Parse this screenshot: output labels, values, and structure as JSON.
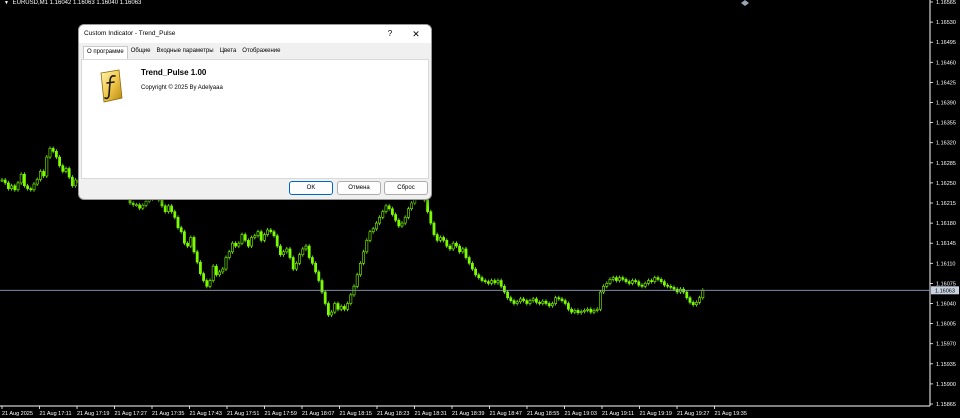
{
  "chart": {
    "symbol_label": "EURUSD,M1",
    "ohlc": "1.16042 1.16063 1.16040 1.16063",
    "current_price": "1.16063",
    "price_ticks": [
      "1.16565",
      "1.16530",
      "1.16495",
      "1.16460",
      "1.16425",
      "1.16390",
      "1.16355",
      "1.16320",
      "1.16285",
      "1.16250",
      "1.16215",
      "1.16180",
      "1.16145",
      "1.16110",
      "1.16075",
      "1.16040",
      "1.16005",
      "1.15970",
      "1.15935",
      "1.15900",
      "1.15865"
    ],
    "time_ticks": [
      "21 Aug 2025",
      "21 Aug 17:11",
      "21 Aug 17:19",
      "21 Aug 17:27",
      "21 Aug 17:35",
      "21 Aug 17:43",
      "21 Aug 17:51",
      "21 Aug 17:59",
      "21 Aug 18:07",
      "21 Aug 18:15",
      "21 Aug 18:23",
      "21 Aug 18:31",
      "21 Aug 18:39",
      "21 Aug 18:47",
      "21 Aug 18:55",
      "21 Aug 19:03",
      "21 Aug 19:11",
      "21 Aug 19:19",
      "21 Aug 19:27",
      "21 Aug 19:35"
    ],
    "closes": [
      1.16255,
      1.1625,
      1.1624,
      1.16245,
      1.16238,
      1.1625,
      1.16265,
      1.16245,
      1.1624,
      1.16238,
      1.16248,
      1.16256,
      1.1627,
      1.16262,
      1.16295,
      1.1631,
      1.16305,
      1.16295,
      1.1628,
      1.1627,
      1.16275,
      1.1626,
      1.16245,
      1.16255,
      1.1625,
      1.16265,
      1.1628,
      1.1629,
      1.16282,
      1.16295,
      1.16288,
      1.1626,
      1.1625,
      1.16245,
      1.16242,
      1.16236,
      1.1623,
      1.16235,
      1.16243,
      1.16232,
      1.16215,
      1.16212,
      1.16212,
      1.16206,
      1.16211,
      1.16218,
      1.16222,
      1.16226,
      1.1623,
      1.1622,
      1.1621,
      1.162,
      1.1621,
      1.162,
      1.1619,
      1.16172,
      1.16165,
      1.16145,
      1.1614,
      1.16155,
      1.1613,
      1.16112,
      1.16092,
      1.1608,
      1.1607,
      1.1608,
      1.16105,
      1.1609,
      1.16095,
      1.161,
      1.1612,
      1.1613,
      1.16145,
      1.1614,
      1.16145,
      1.1616,
      1.1615,
      1.1614,
      1.16155,
      1.16158,
      1.16165,
      1.1615,
      1.1616,
      1.16168,
      1.16165,
      1.16158,
      1.1614,
      1.16125,
      1.1613,
      1.16135,
      1.1612,
      1.161,
      1.1611,
      1.16125,
      1.16135,
      1.1614,
      1.1612,
      1.1611,
      1.16095,
      1.1608,
      1.1606,
      1.1604,
      1.1602,
      1.16025,
      1.1604,
      1.1603,
      1.16035,
      1.1603,
      1.1604,
      1.16055,
      1.1607,
      1.1609,
      1.1611,
      1.1613,
      1.1615,
      1.16165,
      1.1617,
      1.1618,
      1.1619,
      1.162,
      1.1621,
      1.16205,
      1.16195,
      1.16185,
      1.16175,
      1.1618,
      1.1619,
      1.16205,
      1.16215,
      1.16225,
      1.1623,
      1.16235,
      1.1622,
      1.162,
      1.1618,
      1.1616,
      1.1615,
      1.16155,
      1.1615,
      1.1614,
      1.16135,
      1.16145,
      1.1614,
      1.1613,
      1.16135,
      1.1612,
      1.1611,
      1.161,
      1.1609,
      1.16085,
      1.1608,
      1.16078,
      1.16075,
      1.1608,
      1.16076,
      1.1608,
      1.1607,
      1.1606,
      1.1605,
      1.16045,
      1.1604,
      1.16043,
      1.16048,
      1.16045,
      1.1604,
      1.16045,
      1.16048,
      1.16042,
      1.1604,
      1.16044,
      1.1604,
      1.16036,
      1.1604,
      1.1605,
      1.16048,
      1.16045,
      1.1604,
      1.1603,
      1.16025,
      1.16028,
      1.16024,
      1.16026,
      1.16028,
      1.1603,
      1.16025,
      1.16028,
      1.1603,
      1.1606,
      1.1607,
      1.16075,
      1.16082,
      1.16085,
      1.1608,
      1.16085,
      1.16082,
      1.16078,
      1.16075,
      1.1608,
      1.16078,
      1.16072,
      1.1607,
      1.16075,
      1.1608,
      1.16078,
      1.16085,
      1.16082,
      1.16078,
      1.16072,
      1.1607,
      1.16068,
      1.16065,
      1.1606,
      1.16065,
      1.1606,
      1.1605,
      1.16042,
      1.16038,
      1.16042,
      1.1605,
      1.16063
    ],
    "colors": {
      "background": "#000000",
      "candle": "#7CFC00",
      "price_line": "#8fa3bf",
      "text": "#ffffff"
    }
  },
  "dialog": {
    "title": "Custom Indicator - Trend_Pulse",
    "help_label": "?",
    "close_label": "✕",
    "tabs": [
      "О программе",
      "Общие",
      "Входные параметры",
      "Цвета",
      "Отображение"
    ],
    "active_tab": "О программе",
    "indicator_name": "Trend_Pulse 1.00",
    "copyright": "Copyright © 2025 By Adelyaaa",
    "icon": "indicator-script-icon",
    "buttons": {
      "ok": "OK",
      "cancel": "Отмена",
      "reset": "Сброс"
    }
  }
}
